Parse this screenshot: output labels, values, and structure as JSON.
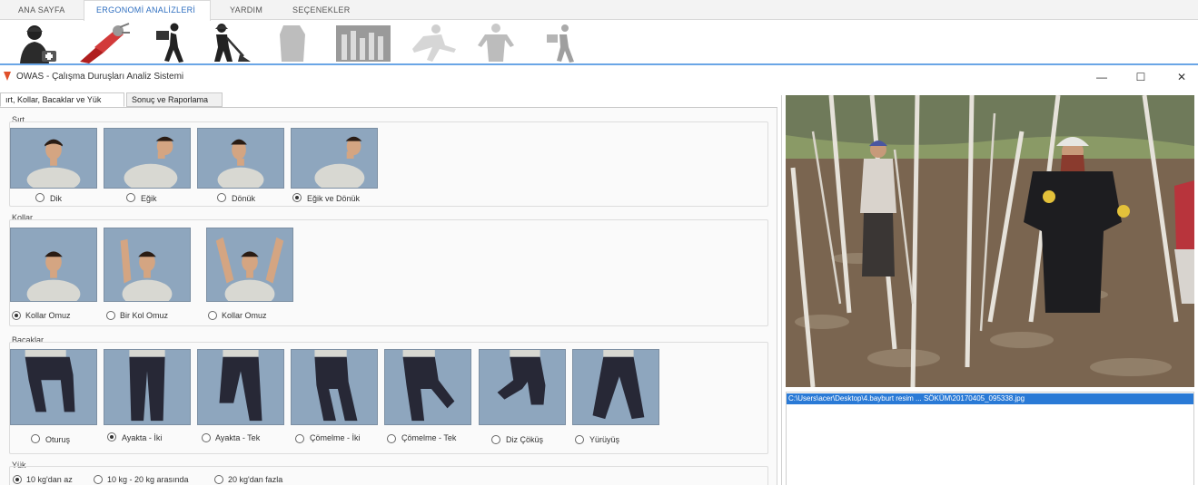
{
  "ribbon": {
    "menu": [
      {
        "label": "ANA SAYFA"
      },
      {
        "label": "ERGONOMİ ANALİZLERİ"
      },
      {
        "label": "YARDIM"
      },
      {
        "label": "SEÇENEKLER"
      }
    ],
    "active_color": "#2f6fc0"
  },
  "window": {
    "title": "OWAS - Çalışma Duruşları Analiz Sistemi",
    "minimize": "—",
    "maximize": "☐",
    "close": "✕"
  },
  "tabs": [
    {
      "label": "ırt, Kollar, Bacaklar ve Yük"
    },
    {
      "label": "Sonuç ve Raporlama"
    }
  ],
  "sections": {
    "sirt": {
      "label": "Sırt",
      "options": [
        {
          "label": "Dik",
          "checked": false
        },
        {
          "label": "Eğik",
          "checked": false
        },
        {
          "label": "Dönük",
          "checked": false
        },
        {
          "label": "Eğik ve Dönük",
          "checked": true
        }
      ]
    },
    "kollar": {
      "label": "Kollar",
      "options": [
        {
          "label": "Kollar Omuz",
          "checked": true
        },
        {
          "label": "Bir Kol Omuz",
          "checked": false
        },
        {
          "label": "Kollar Omuz",
          "checked": false
        }
      ]
    },
    "bacaklar": {
      "label": "Bacaklar",
      "options": [
        {
          "label": "Oturuş",
          "checked": false
        },
        {
          "label": "Ayakta - İki",
          "checked": true
        },
        {
          "label": "Ayakta - Tek",
          "checked": false
        },
        {
          "label": "Çömelme - İki",
          "checked": false
        },
        {
          "label": "Çömelme - Tek",
          "checked": false
        },
        {
          "label": "Diz Çöküş",
          "checked": false
        },
        {
          "label": "Yürüyüş",
          "checked": false
        }
      ]
    },
    "yuk": {
      "label": "Yük",
      "options": [
        {
          "label": "10 kg'dan az",
          "checked": true
        },
        {
          "label": "10 kg - 20 kg arasında",
          "checked": false
        },
        {
          "label": "20 kg'dan fazla",
          "checked": false
        }
      ]
    }
  },
  "file_list": {
    "selected": "C:\\Users\\acer\\Desktop\\4.bayburt resim ... SÖKÜM\\20170405_095338.jpg"
  }
}
